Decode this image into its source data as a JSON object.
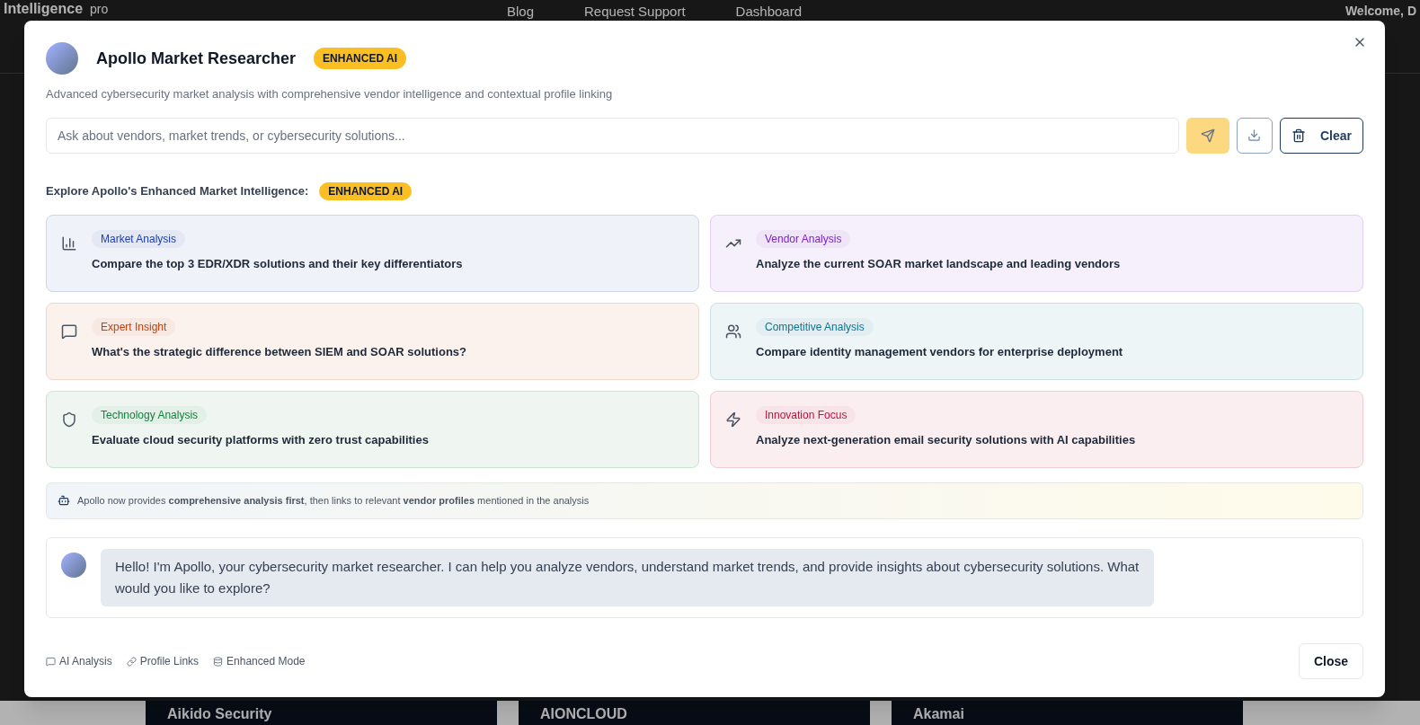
{
  "background_page": {
    "brand": "Intelligence",
    "brand_subtitle": "pro",
    "nav": [
      "Blog",
      "Request Support",
      "Dashboard"
    ],
    "welcome": "Welcome, D",
    "cards": [
      "Aikido Security",
      "AIONCLOUD",
      "Akamai"
    ]
  },
  "dialog": {
    "title": "Apollo Market Researcher",
    "badge": "ENHANCED AI",
    "subtitle": "Advanced cybersecurity market analysis with comprehensive vendor intelligence and contextual profile linking",
    "search": {
      "placeholder": "Ask about vendors, market trends, or cybersecurity solutions..."
    },
    "send_disabled": true,
    "clear_label": "Clear",
    "explore_heading": "Explore Apollo's Enhanced Market Intelligence:",
    "explore_badge": "ENHANCED AI",
    "suggestions": [
      {
        "tag": "Market Analysis",
        "text": "Compare the top 3 EDR/XDR solutions and their key differentiators",
        "color": "#1e40af"
      },
      {
        "tag": "Vendor Analysis",
        "text": "Analyze the current SOAR market landscape and leading vendors",
        "color": "#7e22ce"
      },
      {
        "tag": "Expert Insight",
        "text": "What's the strategic difference between SIEM and SOAR solutions?",
        "color": "#c2410c"
      },
      {
        "tag": "Competitive Analysis",
        "text": "Compare identity management vendors for enterprise deployment",
        "color": "#0e7490"
      },
      {
        "tag": "Technology Analysis",
        "text": "Evaluate cloud security platforms with zero trust capabilities",
        "color": "#15803d"
      },
      {
        "tag": "Innovation Focus",
        "text": "Analyze next-generation email security solutions with AI capabilities",
        "color": "#be123c"
      }
    ],
    "info": "Apollo now provides **comprehensive analysis first**, then links to relevant **vendor profiles** mentioned in the analysis",
    "messages": [
      {
        "text": "Hello! I'm Apollo, your cybersecurity market researcher. I can help you analyze vendors, understand market trends, and provide insights about cybersecurity solutions. What would you like to explore?"
      }
    ],
    "footer_features": [
      "AI Analysis",
      "Profile Links",
      "Enhanced Mode"
    ],
    "close_label": "Close"
  }
}
